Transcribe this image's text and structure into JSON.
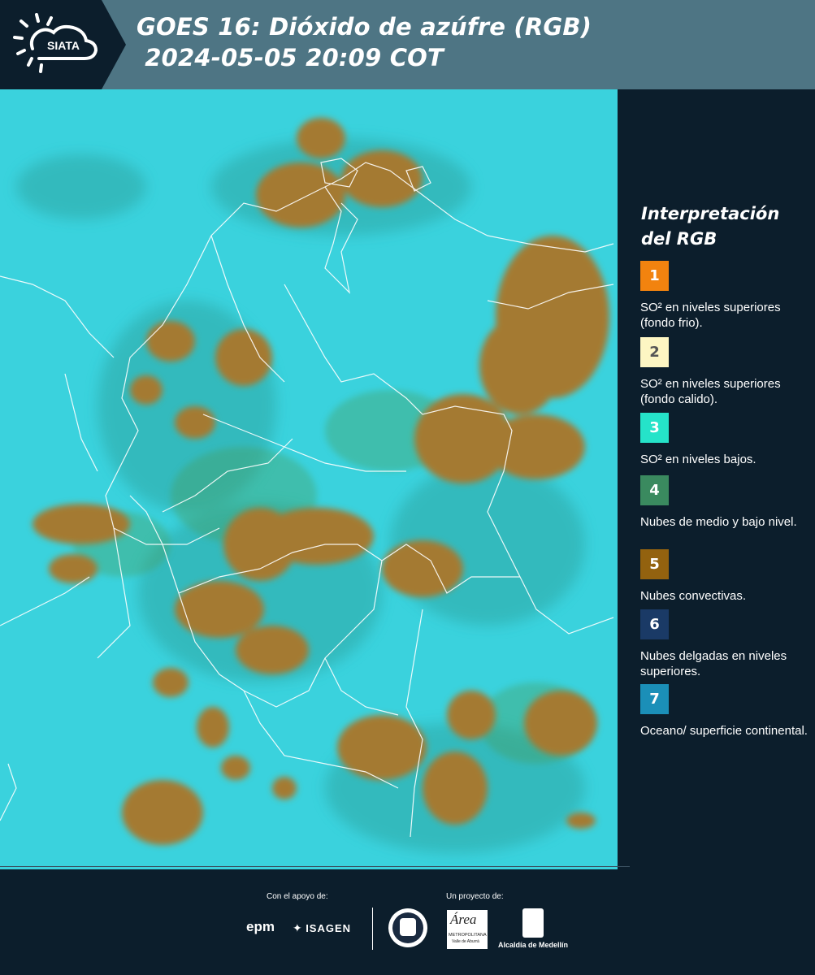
{
  "header": {
    "logo_text": "SIATA",
    "title_line1": "GOES 16: Dióxido de azúfre (RGB)",
    "title_line2": " 2024-05-05 20:09 COT",
    "background": "#4e7584",
    "logo_background": "#0c1e2c"
  },
  "legend": {
    "title_line1": "Interpretación",
    "title_line2": "del RGB",
    "items": [
      {
        "number": "1",
        "label": "SO² en niveles superiores (fondo frio).",
        "color": "#f2830f",
        "text_color": "#ffffff"
      },
      {
        "number": "2",
        "label": "SO² en niveles superiores (fondo calido).",
        "color": "#fdf6c3",
        "text_color": "#555555"
      },
      {
        "number": "3",
        "label": "SO² en niveles bajos.",
        "color": "#25e3c9",
        "text_color": "#ffffff"
      },
      {
        "number": "4",
        "label": "Nubes de medio y bajo nivel.",
        "color": "#3a8a5f",
        "text_color": "#ffffff"
      },
      {
        "number": "5",
        "label": "Nubes convectivas.",
        "color": "#93620f",
        "text_color": "#ffffff"
      },
      {
        "number": "6",
        "label": "Nubes delgadas en niveles superiores.",
        "color": "#1a3a66",
        "text_color": "#ffffff"
      },
      {
        "number": "7",
        "label": "Oceano/ superficie continental.",
        "color": "#1b8fb8",
        "text_color": "#ffffff"
      }
    ]
  },
  "map": {
    "background": "#35cfdb",
    "cloud_color": "#a47a33",
    "border_color": "#ffffff"
  },
  "footer": {
    "support_label": "Con el apoyo de:",
    "project_label": "Un proyecto de:",
    "sponsors": [
      "epm",
      "ISAGEN"
    ],
    "partners": [
      "Área Metropolitana Valle de Aburrá",
      "Alcaldía de Medellín"
    ],
    "area_line1": "Área",
    "area_line2": "METROPOLITANA",
    "area_line3": "Valle de Aburrá",
    "alcaldia": "Alcaldía de Medellín"
  }
}
